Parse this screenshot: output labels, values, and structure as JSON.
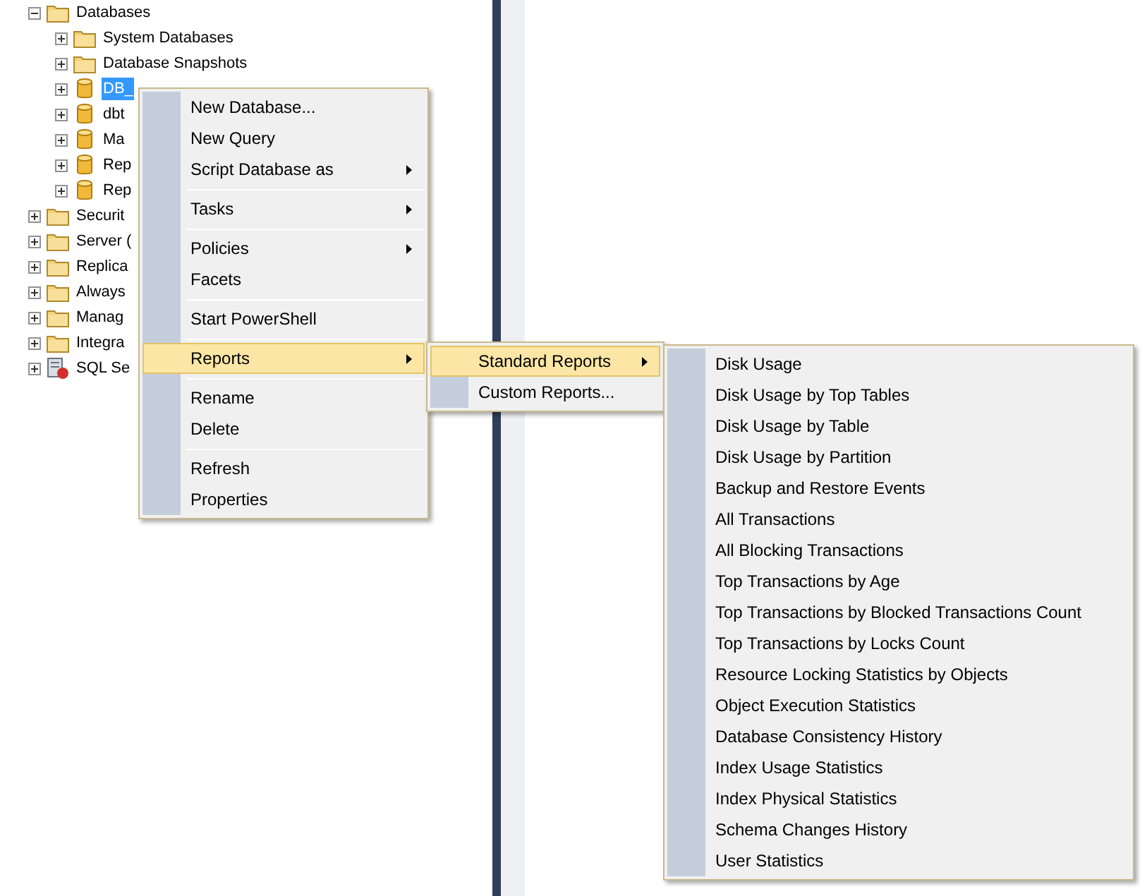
{
  "tree": [
    {
      "label": "Databases",
      "kind": "folder",
      "expanded": true,
      "selected": false,
      "children": [
        {
          "label": "System Databases",
          "kind": "folder",
          "expanded": false,
          "selected": false
        },
        {
          "label": "Database Snapshots",
          "kind": "folder",
          "expanded": false,
          "selected": false
        },
        {
          "label": "DB_",
          "kind": "database",
          "expanded": false,
          "selected": true
        },
        {
          "label": "dbt",
          "kind": "database",
          "expanded": false,
          "selected": false
        },
        {
          "label": "Ma",
          "kind": "database",
          "expanded": false,
          "selected": false
        },
        {
          "label": "Rep",
          "kind": "database",
          "expanded": false,
          "selected": false
        },
        {
          "label": "Rep",
          "kind": "database",
          "expanded": false,
          "selected": false
        }
      ]
    },
    {
      "label": "Securit",
      "kind": "folder",
      "expanded": false,
      "selected": false
    },
    {
      "label": "Server (",
      "kind": "folder",
      "expanded": false,
      "selected": false
    },
    {
      "label": "Replica",
      "kind": "folder",
      "expanded": false,
      "selected": false
    },
    {
      "label": "Always",
      "kind": "folder",
      "expanded": false,
      "selected": false
    },
    {
      "label": "Manag",
      "kind": "folder",
      "expanded": false,
      "selected": false
    },
    {
      "label": "Integra",
      "kind": "folder",
      "expanded": false,
      "selected": false
    },
    {
      "label": "SQL Se",
      "kind": "agent",
      "expanded": false,
      "selected": false
    }
  ],
  "context_menu": [
    {
      "kind": "item",
      "label": "New Database...",
      "submenu": false,
      "selected": false
    },
    {
      "kind": "item",
      "label": "New Query",
      "submenu": false,
      "selected": false
    },
    {
      "kind": "item",
      "label": "Script Database as",
      "submenu": true,
      "selected": false
    },
    {
      "kind": "separator"
    },
    {
      "kind": "item",
      "label": "Tasks",
      "submenu": true,
      "selected": false
    },
    {
      "kind": "separator"
    },
    {
      "kind": "item",
      "label": "Policies",
      "submenu": true,
      "selected": false
    },
    {
      "kind": "item",
      "label": "Facets",
      "submenu": false,
      "selected": false
    },
    {
      "kind": "separator"
    },
    {
      "kind": "item",
      "label": "Start PowerShell",
      "submenu": false,
      "selected": false
    },
    {
      "kind": "separator"
    },
    {
      "kind": "item",
      "label": "Reports",
      "submenu": true,
      "selected": true
    },
    {
      "kind": "separator"
    },
    {
      "kind": "item",
      "label": "Rename",
      "submenu": false,
      "selected": false
    },
    {
      "kind": "item",
      "label": "Delete",
      "submenu": false,
      "selected": false
    },
    {
      "kind": "separator"
    },
    {
      "kind": "item",
      "label": "Refresh",
      "submenu": false,
      "selected": false
    },
    {
      "kind": "item",
      "label": "Properties",
      "submenu": false,
      "selected": false
    }
  ],
  "reports_menu": [
    {
      "kind": "item",
      "label": "Standard Reports",
      "submenu": true,
      "selected": true
    },
    {
      "kind": "item",
      "label": "Custom Reports...",
      "submenu": false,
      "selected": false
    }
  ],
  "standard_reports_menu": [
    {
      "kind": "item",
      "label": "Disk Usage",
      "submenu": false,
      "selected": false
    },
    {
      "kind": "item",
      "label": "Disk Usage by Top Tables",
      "submenu": false,
      "selected": false
    },
    {
      "kind": "item",
      "label": "Disk Usage by Table",
      "submenu": false,
      "selected": false
    },
    {
      "kind": "item",
      "label": "Disk Usage by Partition",
      "submenu": false,
      "selected": false
    },
    {
      "kind": "item",
      "label": "Backup and Restore Events",
      "submenu": false,
      "selected": false
    },
    {
      "kind": "item",
      "label": "All Transactions",
      "submenu": false,
      "selected": false
    },
    {
      "kind": "item",
      "label": "All Blocking Transactions",
      "submenu": false,
      "selected": false
    },
    {
      "kind": "item",
      "label": "Top Transactions by Age",
      "submenu": false,
      "selected": false
    },
    {
      "kind": "item",
      "label": "Top Transactions by Blocked Transactions Count",
      "submenu": false,
      "selected": false
    },
    {
      "kind": "item",
      "label": "Top Transactions by Locks Count",
      "submenu": false,
      "selected": false
    },
    {
      "kind": "item",
      "label": "Resource Locking Statistics by Objects",
      "submenu": false,
      "selected": false
    },
    {
      "kind": "item",
      "label": "Object Execution Statistics",
      "submenu": false,
      "selected": false
    },
    {
      "kind": "item",
      "label": "Database Consistency History",
      "submenu": false,
      "selected": false
    },
    {
      "kind": "item",
      "label": "Index Usage Statistics",
      "submenu": false,
      "selected": false
    },
    {
      "kind": "item",
      "label": "Index Physical Statistics",
      "submenu": false,
      "selected": false
    },
    {
      "kind": "item",
      "label": "Schema Changes History",
      "submenu": false,
      "selected": false
    },
    {
      "kind": "item",
      "label": "User Statistics",
      "submenu": false,
      "selected": false
    }
  ]
}
